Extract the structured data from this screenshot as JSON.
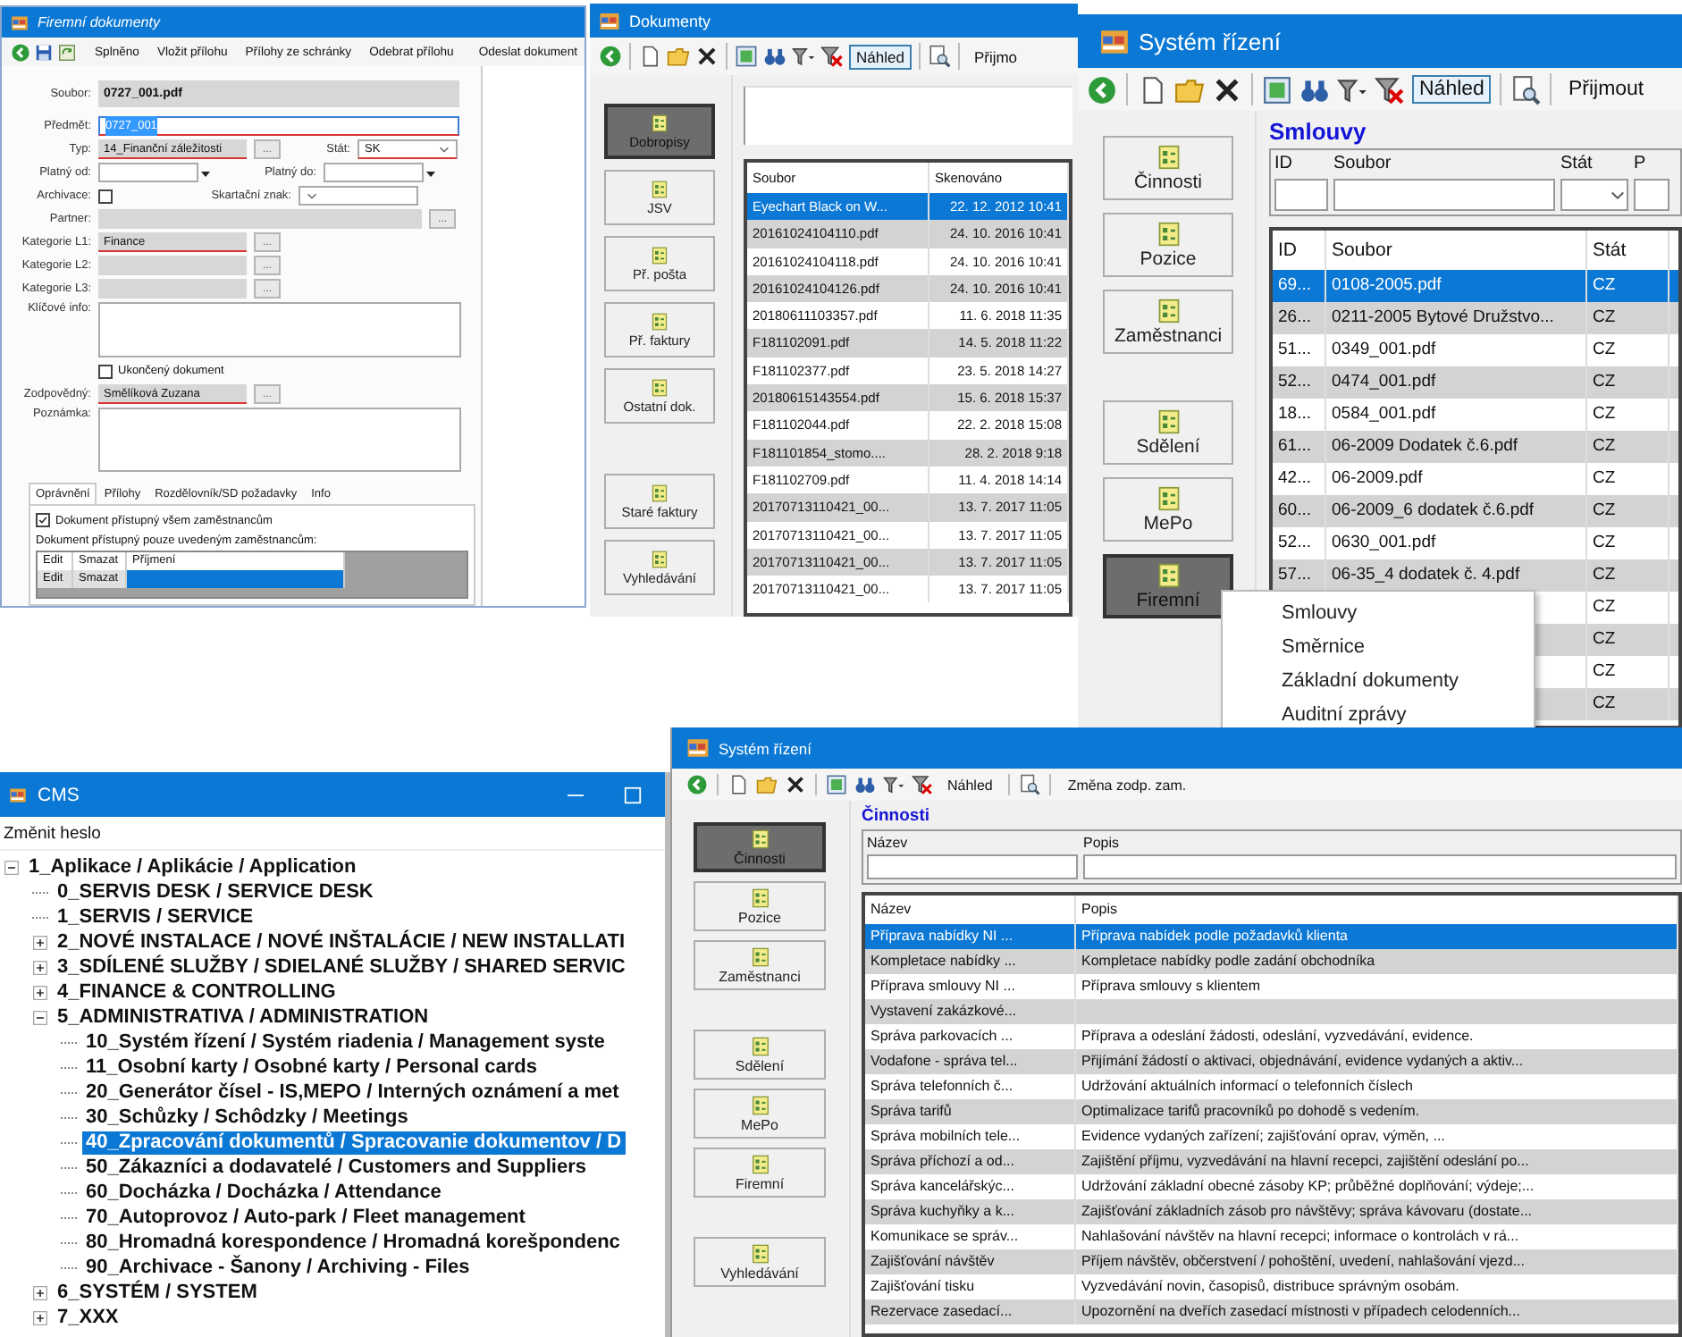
{
  "document_form": {
    "title": "Firemní dokumenty",
    "toolbar": [
      "Splněno",
      "Vložit přílohu",
      "Přílohy ze schránky",
      "Odebrat přílohu",
      "Odeslat dokument"
    ],
    "file": {
      "label": "Soubor:",
      "value": "0727_001.pdf"
    },
    "subject": {
      "label": "Předmět:",
      "value": "0727_001",
      "required": true
    },
    "type": {
      "label": "Typ:",
      "value": "14_Finanční záležitosti",
      "button": "...",
      "required": true
    },
    "country": {
      "label": "Stát:",
      "value": "SK",
      "required": true
    },
    "valid_from": {
      "label": "Platný od:"
    },
    "valid_to": {
      "label": "Platný do:"
    },
    "archive": {
      "label": "Archivace:",
      "checked": false
    },
    "shred_mark": {
      "label": "Skartační znak:"
    },
    "partner": {
      "label": "Partner:",
      "button": "..."
    },
    "categories": [
      {
        "label": "Kategorie L1:",
        "value": "Finance",
        "button": "...",
        "required": true
      },
      {
        "label": "Kategorie L2:",
        "button": "...",
        "required": false
      },
      {
        "label": "Kategorie L3:",
        "button": "...",
        "required": false
      }
    ],
    "key_info": {
      "label": "Klíčové info:"
    },
    "finished": {
      "label": "Ukončený dokument",
      "checked": false
    },
    "responsible": {
      "label": "Zodpovědný:",
      "value": "Smělíková Zuzana",
      "button": "...",
      "required": true
    },
    "note": {
      "label": "Poznámka:"
    },
    "tabs": [
      {
        "label": "Oprávnění",
        "selected": true
      },
      {
        "label": "Přílohy",
        "selected": false
      },
      {
        "label": "Rozdělovník/SD požadavky",
        "selected": false
      },
      {
        "label": "Info",
        "selected": false
      }
    ],
    "all_access": {
      "label": "Dokument přístupný všem zaměstnancům",
      "checked": true
    },
    "restricted_label": "Dokument přístupný pouze uvedeným zaměstnancům:",
    "grid": {
      "columns": [
        "Edit",
        "Smazat",
        "Příjmení"
      ],
      "rows": [
        {
          "cells": [
            "Edit",
            "Smazat"
          ],
          "selected": true
        }
      ]
    }
  },
  "documents_window": {
    "title": "Dokumenty",
    "toolbar": {
      "preview": {
        "label": "Náhled",
        "checked": true
      },
      "action": "Přijmo"
    },
    "nav": [
      [
        {
          "label": "Dobropisy",
          "selected": true
        },
        {
          "label": "JSV",
          "selected": false
        },
        {
          "label": "Př. pošta",
          "selected": false
        },
        {
          "label": "Př. faktury",
          "selected": false
        },
        {
          "label": "Ostatní dok.",
          "selected": false
        }
      ],
      [
        {
          "label": "Staré faktury",
          "selected": false
        },
        {
          "label": "Vyhledávání",
          "selected": false
        }
      ]
    ],
    "columns": [
      "Soubor",
      "Skenováno"
    ],
    "rows": [
      {
        "file": "Eyechart Black on W...",
        "scanned": "22. 12. 2012 10:41",
        "selected": true
      },
      {
        "file": "20161024104110.pdf",
        "scanned": "24. 10. 2016 10:41",
        "selected": false
      },
      {
        "file": "20161024104118.pdf",
        "scanned": "24. 10. 2016 10:41",
        "selected": false
      },
      {
        "file": "20161024104126.pdf",
        "scanned": "24. 10. 2016 10:41",
        "selected": false
      },
      {
        "file": "20180611103357.pdf",
        "scanned": "11. 6. 2018 11:35",
        "selected": false
      },
      {
        "file": "F181102091.pdf",
        "scanned": "14. 5. 2018 11:22",
        "selected": false
      },
      {
        "file": "F181102377.pdf",
        "scanned": "23. 5. 2018 14:27",
        "selected": false
      },
      {
        "file": "20180615143554.pdf",
        "scanned": "15. 6. 2018 15:37",
        "selected": false
      },
      {
        "file": "F181102044.pdf",
        "scanned": "22. 2. 2018 15:08",
        "selected": false
      },
      {
        "file": "F181101854_stomo....",
        "scanned": "28. 2. 2018 9:18",
        "selected": false
      },
      {
        "file": "F181102709.pdf",
        "scanned": "11. 4. 2018 14:14",
        "selected": false
      },
      {
        "file": "20170713110421_00...",
        "scanned": "13. 7. 2017 11:05",
        "selected": false
      },
      {
        "file": "20170713110421_00...",
        "scanned": "13. 7. 2017 11:05",
        "selected": false
      },
      {
        "file": "20170713110421_00...",
        "scanned": "13. 7. 2017 11:05",
        "selected": false
      },
      {
        "file": "20170713110421_00...",
        "scanned": "13. 7. 2017 11:05",
        "selected": false
      }
    ]
  },
  "contracts_window": {
    "title": "Systém řízení",
    "toolbar": {
      "preview": {
        "label": "Náhled",
        "checked": true
      },
      "action": "Přijmout"
    },
    "nav": [
      [
        {
          "label": "Činnosti",
          "selected": false
        },
        {
          "label": "Pozice",
          "selected": false
        },
        {
          "label": "Zaměstnanci",
          "selected": false
        }
      ],
      [
        {
          "label": "Sdělení",
          "selected": false
        },
        {
          "label": "MePo",
          "selected": false
        },
        {
          "label": "Firemní",
          "selected": true
        }
      ]
    ],
    "heading": "Smlouvy",
    "filters": [
      {
        "label": "ID",
        "kind": "text"
      },
      {
        "label": "Soubor",
        "kind": "text"
      },
      {
        "label": "Stát",
        "kind": "dropdown"
      },
      {
        "label": "P",
        "kind": "text"
      }
    ],
    "columns": [
      "ID",
      "Soubor",
      "Stát"
    ],
    "rows": [
      {
        "id": "69...",
        "file": "0108-2005.pdf",
        "state": "CZ",
        "selected": true
      },
      {
        "id": "26...",
        "file": "0211-2005 Bytové Družstvo...",
        "state": "CZ",
        "selected": false
      },
      {
        "id": "51...",
        "file": "0349_001.pdf",
        "state": "CZ",
        "selected": false
      },
      {
        "id": "52...",
        "file": "0474_001.pdf",
        "state": "CZ",
        "selected": false
      },
      {
        "id": "18...",
        "file": "0584_001.pdf",
        "state": "CZ",
        "selected": false
      },
      {
        "id": "61...",
        "file": "06-2009 Dodatek č.6.pdf",
        "state": "CZ",
        "selected": false
      },
      {
        "id": "42...",
        "file": "06-2009.pdf",
        "state": "CZ",
        "selected": false
      },
      {
        "id": "60...",
        "file": "06-2009_6 dodatek č.6.pdf",
        "state": "CZ",
        "selected": false
      },
      {
        "id": "52...",
        "file": "0630_001.pdf",
        "state": "CZ",
        "selected": false
      },
      {
        "id": "57...",
        "file": "06-35_4 dodatek č. 4.pdf",
        "state": "CZ",
        "selected": false
      },
      {
        "state": "CZ",
        "selected": false
      },
      {
        "state": "CZ",
        "selected": false
      },
      {
        "state": "CZ",
        "selected": false
      },
      {
        "state": "CZ",
        "selected": false
      }
    ],
    "context_menu": [
      "Smlouvy",
      "Směrnice",
      "Základní dokumenty",
      "Auditní zprávy"
    ]
  },
  "cms_window": {
    "title": "CMS",
    "menu": [
      "Změnit heslo"
    ],
    "tree": [
      {
        "label": "1_Aplikace / Aplikácie / Application",
        "expanded": true,
        "selected": false,
        "children": [
          {
            "label": "0_SERVIS DESK / SERVICE DESK",
            "selected": false
          },
          {
            "label": "1_SERVIS / SERVICE",
            "selected": false
          },
          {
            "label": "2_NOVÉ INSTALACE / NOVÉ INŠTALÁCIE / NEW INSTALLATI",
            "expanded": false,
            "selected": false
          },
          {
            "label": "3_SDÍLENÉ SLUŽBY / SDIELANÉ SLUŽBY / SHARED SERVIC",
            "expanded": false,
            "selected": false
          },
          {
            "label": "4_FINANCE & CONTROLLING",
            "expanded": false,
            "selected": false
          },
          {
            "label": "5_ADMINISTRATIVA / ADMINISTRATION",
            "expanded": true,
            "selected": false,
            "children": [
              {
                "label": "10_Systém řízení / Systém riadenia / Management syste",
                "selected": false
              },
              {
                "label": "11_Osobní karty / Osobné karty / Personal cards",
                "selected": false
              },
              {
                "label": "20_Generátor čísel - IS,MEPO / Interných oznámení a met",
                "selected": false
              },
              {
                "label": "30_Schůzky / Schôdzky / Meetings",
                "selected": false
              },
              {
                "label": "40_Zpracování dokumentů / Spracovanie dokumentov / D",
                "selected": true
              },
              {
                "label": "50_Zákazníci a dodavatelé / Customers and Suppliers",
                "selected": false
              },
              {
                "label": "60_Docházka / Docházka / Attendance",
                "selected": false
              },
              {
                "label": "70_Autoprovoz / Auto-park / Fleet management",
                "selected": false
              },
              {
                "label": "80_Hromadná korespondence / Hromadná korešpondenc",
                "selected": false
              },
              {
                "label": "90_Archivace - Šanony / Archiving - Files",
                "selected": false
              }
            ]
          },
          {
            "label": "6_SYSTÉM / SYSTEM",
            "expanded": false,
            "selected": false
          },
          {
            "label": "7_XXX",
            "expanded": false,
            "selected": false
          }
        ]
      }
    ]
  },
  "activities_window": {
    "title": "Systém řízení",
    "toolbar": {
      "preview": {
        "label": "Náhled",
        "checked": false
      },
      "action": "Změna zodp. zam."
    },
    "nav": [
      [
        {
          "label": "Činnosti",
          "selected": true
        },
        {
          "label": "Pozice",
          "selected": false
        },
        {
          "label": "Zaměstnanci",
          "selected": false
        }
      ],
      [
        {
          "label": "Sdělení",
          "selected": false
        },
        {
          "label": "MePo",
          "selected": false
        },
        {
          "label": "Firemní",
          "selected": false
        }
      ],
      [
        {
          "label": "Vyhledávání",
          "selected": false
        }
      ]
    ],
    "heading": "Činnosti",
    "filters": [
      "Název",
      "Popis"
    ],
    "columns": [
      "Název",
      "Popis"
    ],
    "rows": [
      {
        "name": "Příprava nabídky NI ...",
        "description": "Příprava nabídek podle požadavků klienta",
        "selected": true
      },
      {
        "name": "Kompletace nabídky ...",
        "description": "Kompletace nabídky podle zadání obchodníka",
        "selected": false
      },
      {
        "name": "Příprava smlouvy NI ...",
        "description": "Příprava smlouvy s klientem",
        "selected": false
      },
      {
        "name": "Vystavení zakázkové...",
        "selected": false
      },
      {
        "name": "Správa parkovacích ...",
        "description": "Příprava a odeslání žádosti, odeslání, vyzvedávání, evidence.",
        "selected": false
      },
      {
        "name": "Vodafone - správa tel...",
        "description": "Přijímání žádostí o aktivaci, objednávání, evidence vydaných a aktiv...",
        "selected": false
      },
      {
        "name": "Správa telefonních č...",
        "description": "Udržování aktuálních informací o telefonních číslech",
        "selected": false
      },
      {
        "name": "Správa tarifů",
        "description": "Optimalizace tarifů pracovníků po dohodě s vedením.",
        "selected": false
      },
      {
        "name": "Správa mobilních tele...",
        "description": "Evidence vydaných zařízení; zajišťování oprav, výměn, ...",
        "selected": false
      },
      {
        "name": "Správa příchozí a od...",
        "description": "Zajištění příjmu, vyzvedávání na hlavní recepci, zajištění odeslání po...",
        "selected": false
      },
      {
        "name": "Správa kancelářskýc...",
        "description": "Udržování základní obecné zásoby KP; průběžné doplňování; výdeje;...",
        "selected": false
      },
      {
        "name": "Správa kuchyňky a k...",
        "description": "Zajišťování základních zásob pro návštěvy; správa kávovaru (dostate...",
        "selected": false
      },
      {
        "name": "Komunikace se správ...",
        "description": "Nahlašování návštěv na hlavní recepci; informace o kontrolách v rá...",
        "selected": false
      },
      {
        "name": "Zajišťování návštěv",
        "description": "Příjem návštěv, občerstvení / pohoštění, uvedení, nahlašování vjezd...",
        "selected": false
      },
      {
        "name": "Zajišťování tisku",
        "description": "Vyzvedávání novin, časopisů, distribuce správným osobám.",
        "selected": false
      },
      {
        "name": "Rezervace zasedací...",
        "description": "Upozornění na dveřích zasedací místnosti v případech celodenních...",
        "selected": false
      }
    ]
  }
}
